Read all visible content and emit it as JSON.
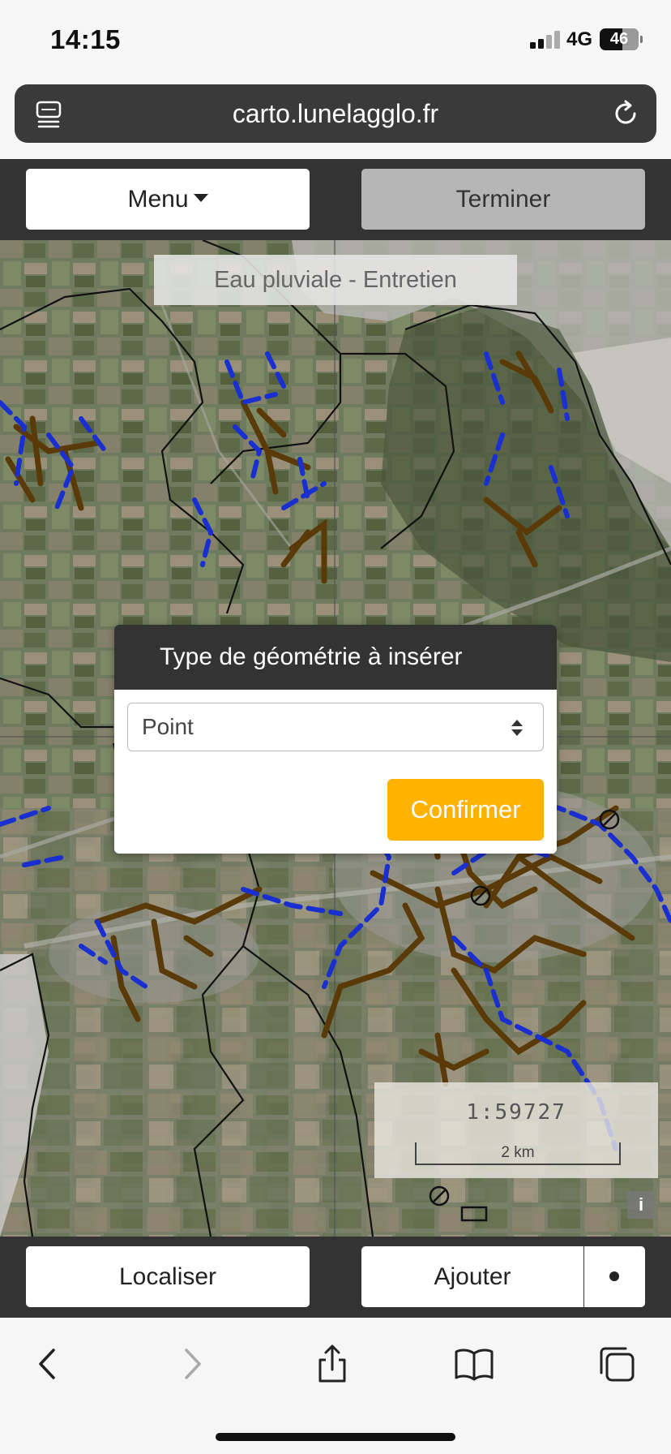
{
  "status_bar": {
    "time": "14:15",
    "network": "4G",
    "battery": "46"
  },
  "browser": {
    "url": "carto.lunelagglo.fr"
  },
  "header": {
    "menu_label": "Menu",
    "finish_label": "Terminer"
  },
  "map": {
    "layer_title": "Eau pluviale - Entretien",
    "scale_ratio": "1:59727",
    "scale_label": "2 km",
    "info_label": "i"
  },
  "dialog": {
    "title": "Type de géométrie à insérer",
    "selected_geometry": "Point",
    "confirm_label": "Confirmer"
  },
  "footer": {
    "locate_label": "Localiser",
    "add_label": "Ajouter"
  },
  "colors": {
    "accent": "#ffb300",
    "bar": "#333333",
    "network_brown": "#5a3a08",
    "network_blue": "#1a2fd0"
  },
  "icons": [
    "tabs-icon",
    "reload-icon",
    "back-icon",
    "forward-icon",
    "share-icon",
    "bookmarks-icon",
    "tabs-overview-icon"
  ]
}
